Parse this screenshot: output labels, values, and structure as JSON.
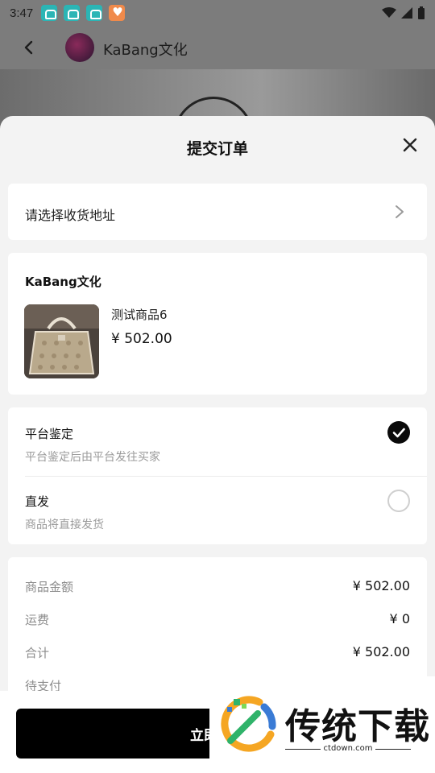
{
  "status_bar": {
    "time": "3:47"
  },
  "top_bar": {
    "title": "KaBang文化"
  },
  "sheet": {
    "title": "提交订单",
    "address": {
      "placeholder_label": "请选择收货地址"
    },
    "product_card": {
      "shop_name": "KaBang文化",
      "product_name": "测试商品6",
      "price": "¥ 502.00"
    },
    "delivery": {
      "options": [
        {
          "title": "平台鉴定",
          "desc": "平台鉴定后由平台发往买家",
          "selected": true
        },
        {
          "title": "直发",
          "desc": "商品将直接发货",
          "selected": false
        }
      ]
    },
    "summary": {
      "rows": [
        {
          "label": "商品金额",
          "value": "¥ 502.00"
        },
        {
          "label": "运费",
          "value": "¥ 0"
        },
        {
          "label": "合计",
          "value": "¥ 502.00"
        },
        {
          "label": "待支付",
          "value": ""
        }
      ]
    },
    "pay_button_label": "立即支付"
  },
  "watermark": {
    "brand": "传统下载",
    "url": "ctdown.com"
  },
  "colors": {
    "accent": "#000000",
    "muted": "#9a9a9a",
    "teal_icon": "#2bb5b5",
    "orange_icon": "#f08a4b"
  }
}
